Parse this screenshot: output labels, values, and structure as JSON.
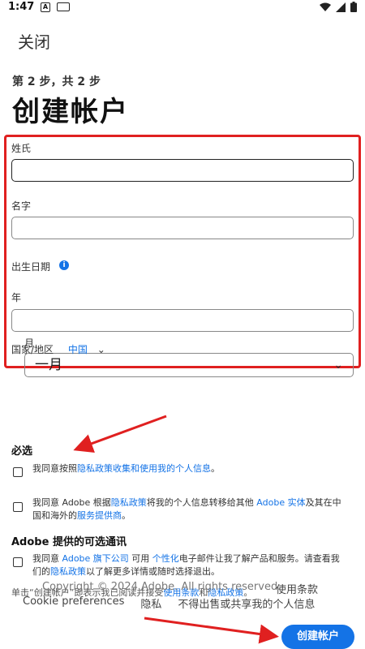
{
  "status_bar": {
    "time": "1:47",
    "a_label": "A"
  },
  "app_bar": {
    "close_label": "关闭"
  },
  "header": {
    "step": "第 2 步，共 2 步",
    "title": "创建帐户"
  },
  "form": {
    "last_name_label": "姓氏",
    "first_name_label": "名字",
    "dob_label": "出生日期",
    "info_glyph": "i",
    "year_label": "年",
    "month_label": "月",
    "month_value": "一月",
    "month_chevron": "⌄"
  },
  "country": {
    "label": "国家/地区",
    "value": "中国",
    "chevron": "⌄"
  },
  "required": {
    "heading": "必选",
    "consent1_prefix": "我同意按照",
    "consent1_link": "隐私政策收集和使用我的个人信息",
    "consent1_suffix": "。",
    "consent2_prefix": "我同意 Adobe 根据",
    "consent2_link1": "隐私政策",
    "consent2_mid": "将我的个人信息转移给其他 ",
    "consent2_link2": "Adobe 实体",
    "consent2_mid2": "及其在中国和海外的",
    "consent2_link3": "服务提供商",
    "consent2_suffix": "。"
  },
  "optional": {
    "heading": "Adobe 提供的可选通讯",
    "consent_prefix": "我同意 ",
    "consent_link1": "Adobe 旗下公司",
    "consent_mid": " 可用 ",
    "consent_link2": "个性化",
    "consent_mid2": "电子邮件让我了解产品和服务。请查看我们的",
    "consent_link3": "隐私政策",
    "consent_suffix": "以了解更多详情或随时选择退出。"
  },
  "footer": {
    "agreement_prefix": "单击“创建帐户”即表示我已阅读并接受",
    "agreement_link1": "使用条款",
    "agreement_and": "和",
    "agreement_link2": "隐私政策",
    "agreement_suffix": "。",
    "copyright": "Copyright © 2024 Adobe. All rights reserved.",
    "terms": "使用条款",
    "cookie": "Cookie preferences",
    "privacy": "隐私",
    "no_sell": "不得出售或共享我的个人信息"
  },
  "create_button": "创建帐户",
  "colors": {
    "accent": "#1473e6",
    "highlight": "#e02020"
  }
}
